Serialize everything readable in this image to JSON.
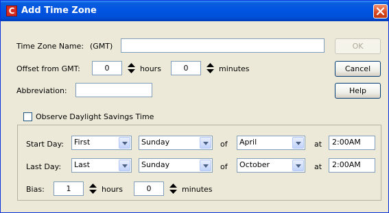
{
  "dialog": {
    "title": "Add Time Zone",
    "app_icon_letter": "C"
  },
  "fields": {
    "tz_name_label": "Time Zone Name:",
    "tz_name_prefix": "(GMT)",
    "tz_name_value": "",
    "offset_label": "Offset from GMT:",
    "offset_hours_value": "0",
    "offset_hours_unit": "hours",
    "offset_minutes_value": "0",
    "offset_minutes_unit": "minutes",
    "abbreviation_label": "Abbreviation:",
    "abbreviation_value": ""
  },
  "buttons": {
    "ok": "OK",
    "cancel": "Cancel",
    "help": "Help"
  },
  "dst": {
    "checkbox_label": "Observe Daylight Savings Time",
    "checked": false,
    "start_label": "Start Day:",
    "start_week": "First",
    "start_weekday": "Sunday",
    "start_of": "of",
    "start_month": "April",
    "start_at": "at",
    "start_time": "2:00AM",
    "last_label": "Last Day:",
    "last_week": "Last",
    "last_weekday": "Sunday",
    "last_of": "of",
    "last_month": "October",
    "last_at": "at",
    "last_time": "2:00AM",
    "bias_label": "Bias:",
    "bias_hours_value": "1",
    "bias_hours_unit": "hours",
    "bias_minutes_value": "0",
    "bias_minutes_unit": "minutes"
  },
  "colors": {
    "titlebar": "#0054e3",
    "window_bg": "#ece9d8",
    "close_button": "#d8461e",
    "field_border": "#7f9db9"
  }
}
